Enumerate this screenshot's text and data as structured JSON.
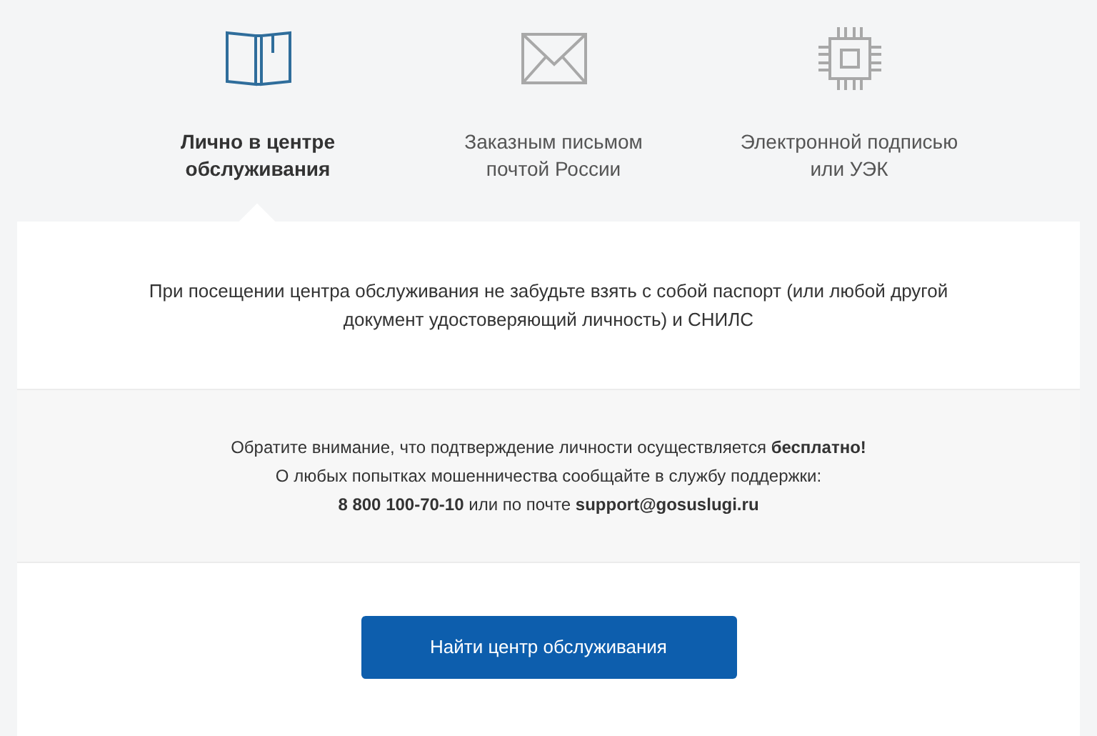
{
  "tabs": [
    {
      "kind": "book",
      "label": "Лично в центре обслуживания",
      "selected": true
    },
    {
      "kind": "envelope",
      "label": "Заказным письмом почтой России",
      "selected": false
    },
    {
      "kind": "chip",
      "label": "Электронной подписью или УЭК",
      "selected": false
    }
  ],
  "reminder": "При посещении центра обслуживания не забудьте взять с собой паспорт (или любой другой документ удостоверяющий личность) и СНИЛС",
  "notice": [
    "Обратите внимание, что подтверждение личности осуществляется **бесплатно!**",
    "О любых попытках мошенничества сообщайте в службу поддержки:",
    "**8 800 100-70-10** или по почте **support@gosuslugi.ru**"
  ],
  "button": "Найти центр обслуживания"
}
